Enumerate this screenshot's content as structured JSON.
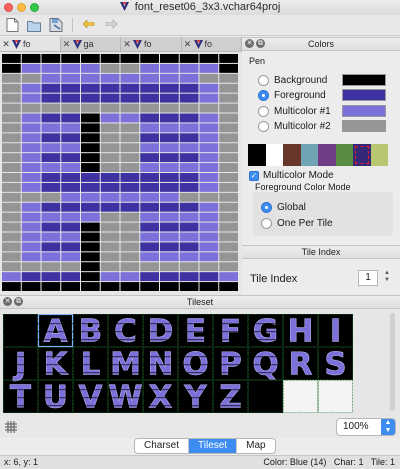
{
  "window": {
    "title": "font_reset06_3x3.vchar64proj"
  },
  "toolbar": {
    "buttons": [
      "new-file-icon",
      "open-file-icon",
      "save-file-icon",
      "undo-icon",
      "redo-icon"
    ]
  },
  "doc_tabs": [
    {
      "label": "fo",
      "active": true
    },
    {
      "label": "ga"
    },
    {
      "label": "fo"
    },
    {
      "label": "fo"
    }
  ],
  "colors": {
    "title": "Colors",
    "pen_label": "Pen"
  },
  "pens": [
    {
      "label": "Background",
      "swatch": "#000000",
      "selected": false
    },
    {
      "label": "Foreground",
      "swatch": "#3e31a2",
      "selected": true
    },
    {
      "label": "Multicolor #1",
      "swatch": "#7c70da",
      "selected": false
    },
    {
      "label": "Multicolor #2",
      "swatch": "#959595",
      "selected": false
    }
  ],
  "palette": [
    "#000000",
    "#ffffff",
    "#68372b",
    "#70a4b2",
    "#6f3d86",
    "#588d43",
    "#352879",
    "#b8c76f"
  ],
  "multicolor_mode": {
    "label": "Multicolor Mode",
    "checked": true
  },
  "fg_color_mode": {
    "label": "Foreground Color Mode",
    "options": [
      "Global",
      "One Per Tile"
    ],
    "selected": 0
  },
  "tile_index": {
    "title": "Tile Index",
    "label": "Tile Index",
    "value": "1"
  },
  "tileset": {
    "title": "Tileset",
    "letters": [
      "A",
      "B",
      "C",
      "D",
      "E",
      "F",
      "G",
      "H",
      "I",
      "J",
      "K",
      "L",
      "M",
      "N",
      "O",
      "P",
      "Q",
      "R",
      "S",
      "T",
      "U",
      "V",
      "W",
      "X",
      "Y",
      "Z"
    ]
  },
  "zoom": {
    "value": "100%"
  },
  "views": [
    {
      "label": "Charset",
      "active": false
    },
    {
      "label": "Tileset",
      "active": true
    },
    {
      "label": "Map",
      "active": false
    }
  ],
  "status": {
    "coords": "x: 6, y: 1",
    "color": "Color: Blue (14)",
    "char": "Char:",
    "char_value": "1",
    "tile": "Tile:",
    "tile_value": "1"
  },
  "theme": {
    "fg": "#3e31a2",
    "mc1": "#7c70da",
    "mc2": "#959595",
    "bg": "#000000",
    "accent": "#3d8cf0"
  }
}
